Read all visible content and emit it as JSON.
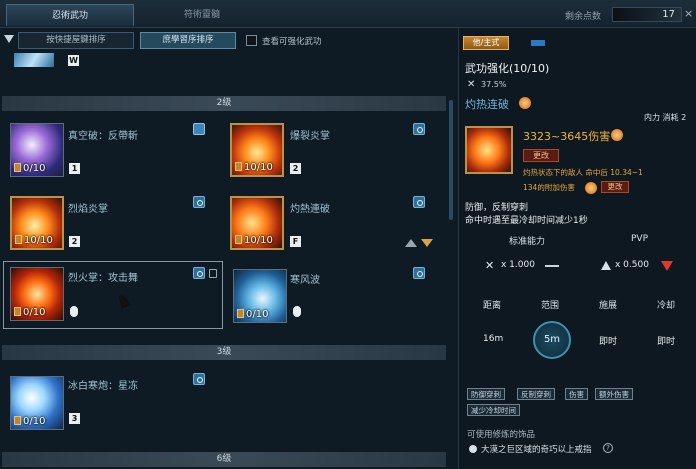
{
  "tabs": [
    {
      "label": "忍術武功"
    },
    {
      "label": "符術靈髓"
    }
  ],
  "points": {
    "label": "剩余点数",
    "value": "17"
  },
  "filters": {
    "btn1": "按快捷屋鍵排序",
    "btn2": "庶學習序排序",
    "checkbox_label": "查看可强化武功"
  },
  "top_key": "W",
  "grades": {
    "g2": "2级",
    "g3": "3级",
    "g6": "6级"
  },
  "skills": [
    {
      "name": "真空破：反帶斬",
      "level": "0/10",
      "key": "1"
    },
    {
      "name": "爆裂炎掌",
      "level": "10/10",
      "key": "2"
    },
    {
      "name": "烈焰炎掌",
      "level": "10/10",
      "key": "2"
    },
    {
      "name": "灼熱連破",
      "level": "10/10",
      "key": "F"
    },
    {
      "name": "烈火掌：攻击舞",
      "level": "0/10",
      "key": ""
    },
    {
      "name": "寒风波",
      "level": "0/10",
      "key": ""
    },
    {
      "name": "冰白寒炮：星冻",
      "level": "0/10",
      "key": "3"
    }
  ],
  "detail": {
    "mode_tag": "他/主式",
    "title": "武功强化(10/10)",
    "percent": "37.5%",
    "skill_name": "灼热连破",
    "cost": "内力 消耗 2",
    "damage": "3323~3645伤害",
    "change_label": "更改",
    "desc1": "灼热状态下的敌人 命中后 10.34~1",
    "desc2": "134的附加伤害",
    "change_label2": "更改",
    "effect1": "防御，反制穿刺",
    "effect2": "命中时遇至最冷却时间减少1秒",
    "col_std": "标准能力",
    "col_pvp": "PVP",
    "mult_std": "x 1.000",
    "mult_pvp": "x 0.500",
    "attrs": [
      "距离",
      "范围",
      "施展",
      "冷却"
    ],
    "vals": [
      "16m",
      "5m",
      "即时",
      "即时"
    ],
    "tags": [
      "防御穿刺",
      "反制穿刺",
      "伤害",
      "额外伤害",
      "减少冷却时间"
    ],
    "equip_title": "可使用修炼的饰品",
    "equip_item": "大漠之巨区域的奇巧以上戒指"
  }
}
